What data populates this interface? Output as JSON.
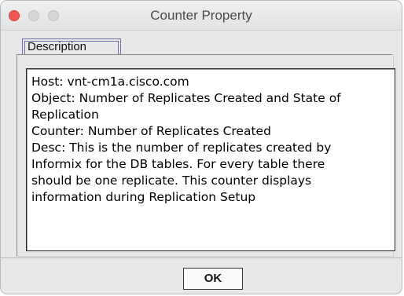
{
  "window": {
    "title": "Counter Property"
  },
  "tabs": [
    {
      "label": "Description"
    }
  ],
  "description_lines": [
    "Host: vnt-cm1a.cisco.com",
    "Object: Number of Replicates Created and State of",
    "Replication",
    "Counter: Number of Replicates Created",
    "Desc: This is the number of replicates created by",
    "Informix for the DB tables. For every table there",
    "should be one replicate. This counter displays",
    "information during Replication Setup"
  ],
  "buttons": {
    "ok_label": "OK"
  },
  "colors": {
    "close": "#ee5a52",
    "inactive_traffic": "#d6d6d6",
    "tab_border": "#7070a8"
  },
  "icons": [
    "close-window-icon",
    "minimize-window-icon",
    "zoom-window-icon"
  ]
}
